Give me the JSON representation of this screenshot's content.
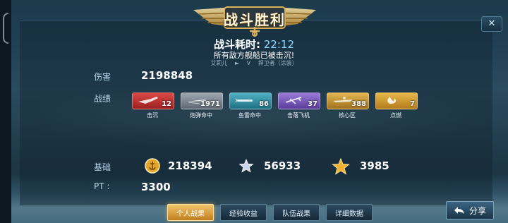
{
  "banner": {
    "title": "战斗胜利"
  },
  "battle": {
    "time_label": "战斗耗时:",
    "time_value": "22:12",
    "result_text": "所有敌方舰船已被击沉!",
    "player": "艾莉儿",
    "vs": "V",
    "opponent": "捍卫者（涂装）"
  },
  "damage": {
    "label": "伤害",
    "value": "2198848"
  },
  "record": {
    "label": "战绩",
    "items": [
      {
        "label": "击沉",
        "count": "12",
        "icon": "plane-icon"
      },
      {
        "label": "炮弹命中",
        "count": "1971",
        "icon": "shell-icon"
      },
      {
        "label": "鱼雷命中",
        "count": "86",
        "icon": "torpedo-icon"
      },
      {
        "label": "击落飞机",
        "count": "37",
        "icon": "aircraft-icon"
      },
      {
        "label": "核心区",
        "count": "388",
        "icon": "core-hit-icon"
      },
      {
        "label": "点燃",
        "count": "7",
        "icon": "fire-icon"
      }
    ]
  },
  "base": {
    "label": "基础",
    "coins": "218394",
    "silver_stars": "56933",
    "gold_stars": "3985"
  },
  "pt": {
    "label": "PT :",
    "value": "3300"
  },
  "tabs": [
    "个人战果",
    "经验收益",
    "队伍战果",
    "详细数据"
  ],
  "share_label": "分享",
  "close_label": "✕",
  "colors": {
    "active_tab": "#e0a640",
    "time_value": "#8fd8ff",
    "panel": "#1b3a4a"
  }
}
